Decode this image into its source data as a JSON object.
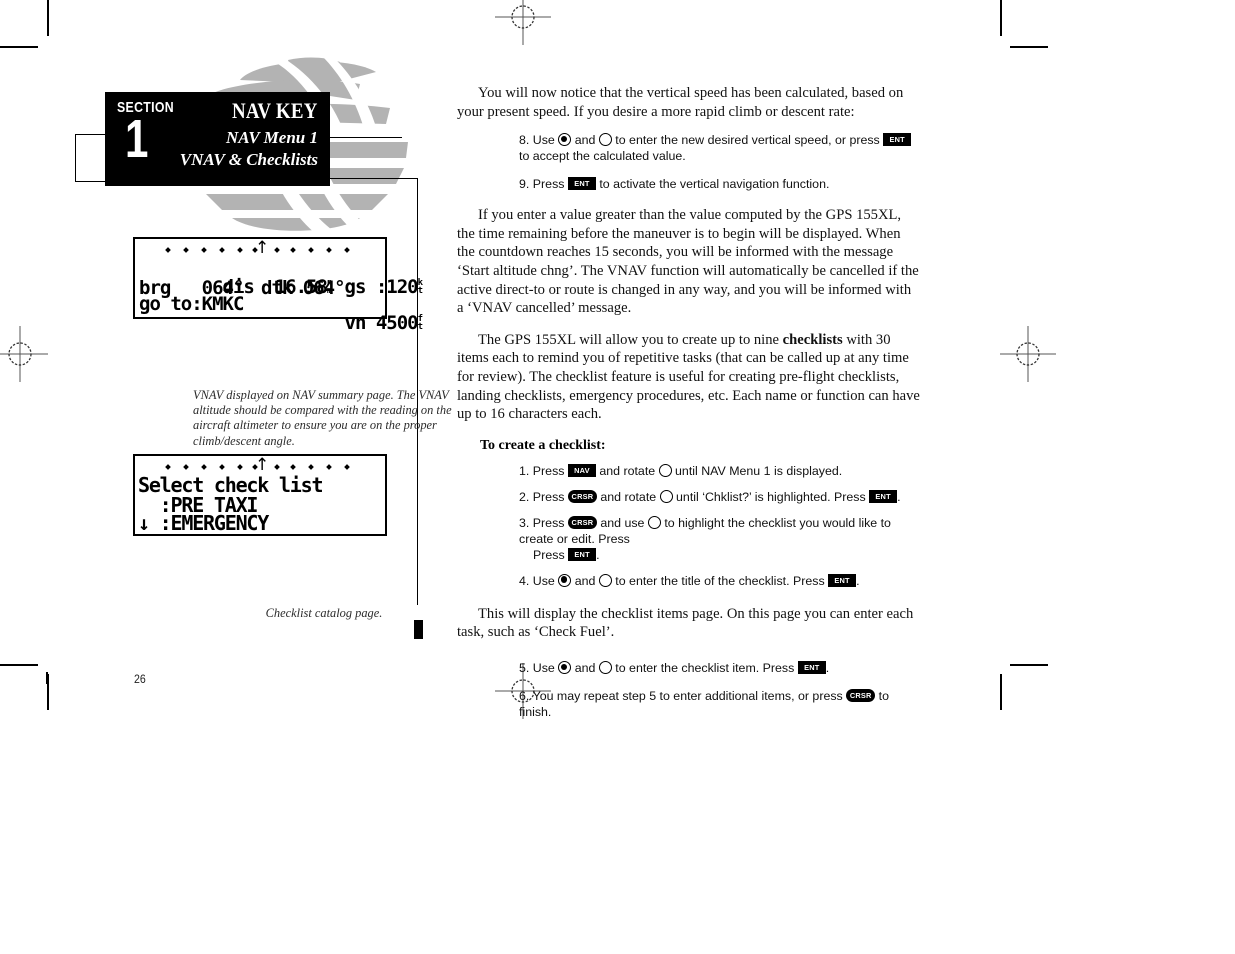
{
  "document": {
    "page_number": "26",
    "section_header": {
      "section_label": "SECTION",
      "section_number": "1",
      "title": "NAV KEY",
      "subtitle_1": "NAV Menu 1",
      "subtitle_2": "VNAV & Checklists"
    }
  },
  "gps_screens": [
    {
      "name": "nav-summary-page",
      "rows": [
        {
          "left": "dis  16.58",
          "left_unit": "nm",
          "right": "gs :120",
          "right_unit": "kt"
        },
        {
          "left": "brg   064°",
          "left_unit": "",
          "right": "dtk 064°",
          "right_unit": ""
        },
        {
          "left": "go to:KMKC",
          "left_unit": "",
          "right": "vn 4500",
          "right_unit": "ft"
        }
      ],
      "caption": "VNAV displayed on NAV summary page. The VNAV altitude should be compared with the reading on the aircraft altimeter to ensure you are on the proper climb/descent angle."
    },
    {
      "name": "checklist-catalog-page",
      "lines": [
        "Select check list",
        "  :PRE TAXI",
        "↓ :EMERGENCY"
      ],
      "caption": "Checklist catalog page."
    }
  ],
  "body": {
    "paragraph_1": "You will now notice that the vertical speed has been calculated, based on your present speed. If you desire a more rapid climb or descent rate:",
    "step_8": {
      "number": "8. ",
      "t1": "Use ",
      "t2": " and ",
      "t3": " to enter the new desired vertical speed, or press ",
      "key": "ENT",
      "t4": " to accept the calculated value."
    },
    "step_9": {
      "number": "9. ",
      "t1": "Press ",
      "key": "ENT",
      "t2": " to activate the vertical navigation function."
    },
    "paragraph_2": "If you enter a value greater than the value computed by the GPS 155XL, the time remaining before the maneuver is to begin will be displayed. When the countdown reaches 15 seconds, you will be informed with the message ‘Start altitude chng’. The VNAV function will automatically be cancelled if the active direct-to or route is changed in any way, and you will be informed with a ‘VNAV cancelled’ message.",
    "paragraph_3_a": "The GPS 155XL will allow you to create up to nine ",
    "paragraph_3_bold": "checklists",
    "paragraph_3_b": " with 30 items each to remind you of repetitive tasks (that can be called up at any time for review). The checklist feature is useful for creating pre-flight checklists, landing checklists, emergency procedures, etc. Each name or function can have up to 16 characters each.",
    "sub_heading": "To create a checklist:",
    "step_1": {
      "number": "1. ",
      "t1": "Press ",
      "key1": "NAV",
      "t2": " and rotate ",
      "t3": " until NAV Menu 1 is displayed."
    },
    "step_2": {
      "number": "2. ",
      "t1": "Press ",
      "key1": "CRSR",
      "t2": " and rotate ",
      "t3": " until ‘Chklist?’ is highlighted. Press ",
      "key2": "ENT",
      "t4": "."
    },
    "step_3": {
      "number": "3. ",
      "t1": "Press ",
      "key1": "CRSR",
      "t2": " and use ",
      "t3": " to highlight the checklist you would like to create or edit. Press ",
      "key2": "ENT",
      "t4": "."
    },
    "step_4": {
      "number": "4. ",
      "t1": "Use ",
      "t2": " and ",
      "t3": " to enter the title of the checklist. Press ",
      "key": "ENT",
      "t4": "."
    },
    "paragraph_4": "This will display the checklist items page. On this page you can enter each task, such as ‘Check Fuel’.",
    "step_5": {
      "number": "5. ",
      "t1": "Use ",
      "t2": " and ",
      "t3": " to enter the checklist item. Press ",
      "key": "ENT",
      "t4": "."
    },
    "step_6": {
      "number": "6. ",
      "t1": "You may repeat step 5 to enter additional items, or press ",
      "key": "CRSR",
      "t2": " to finish."
    }
  },
  "colors": {
    "ink": "#000000",
    "paper": "#ffffff",
    "globe_gray": "#b3b3b3",
    "caption_gray": "#2b2b2b"
  }
}
